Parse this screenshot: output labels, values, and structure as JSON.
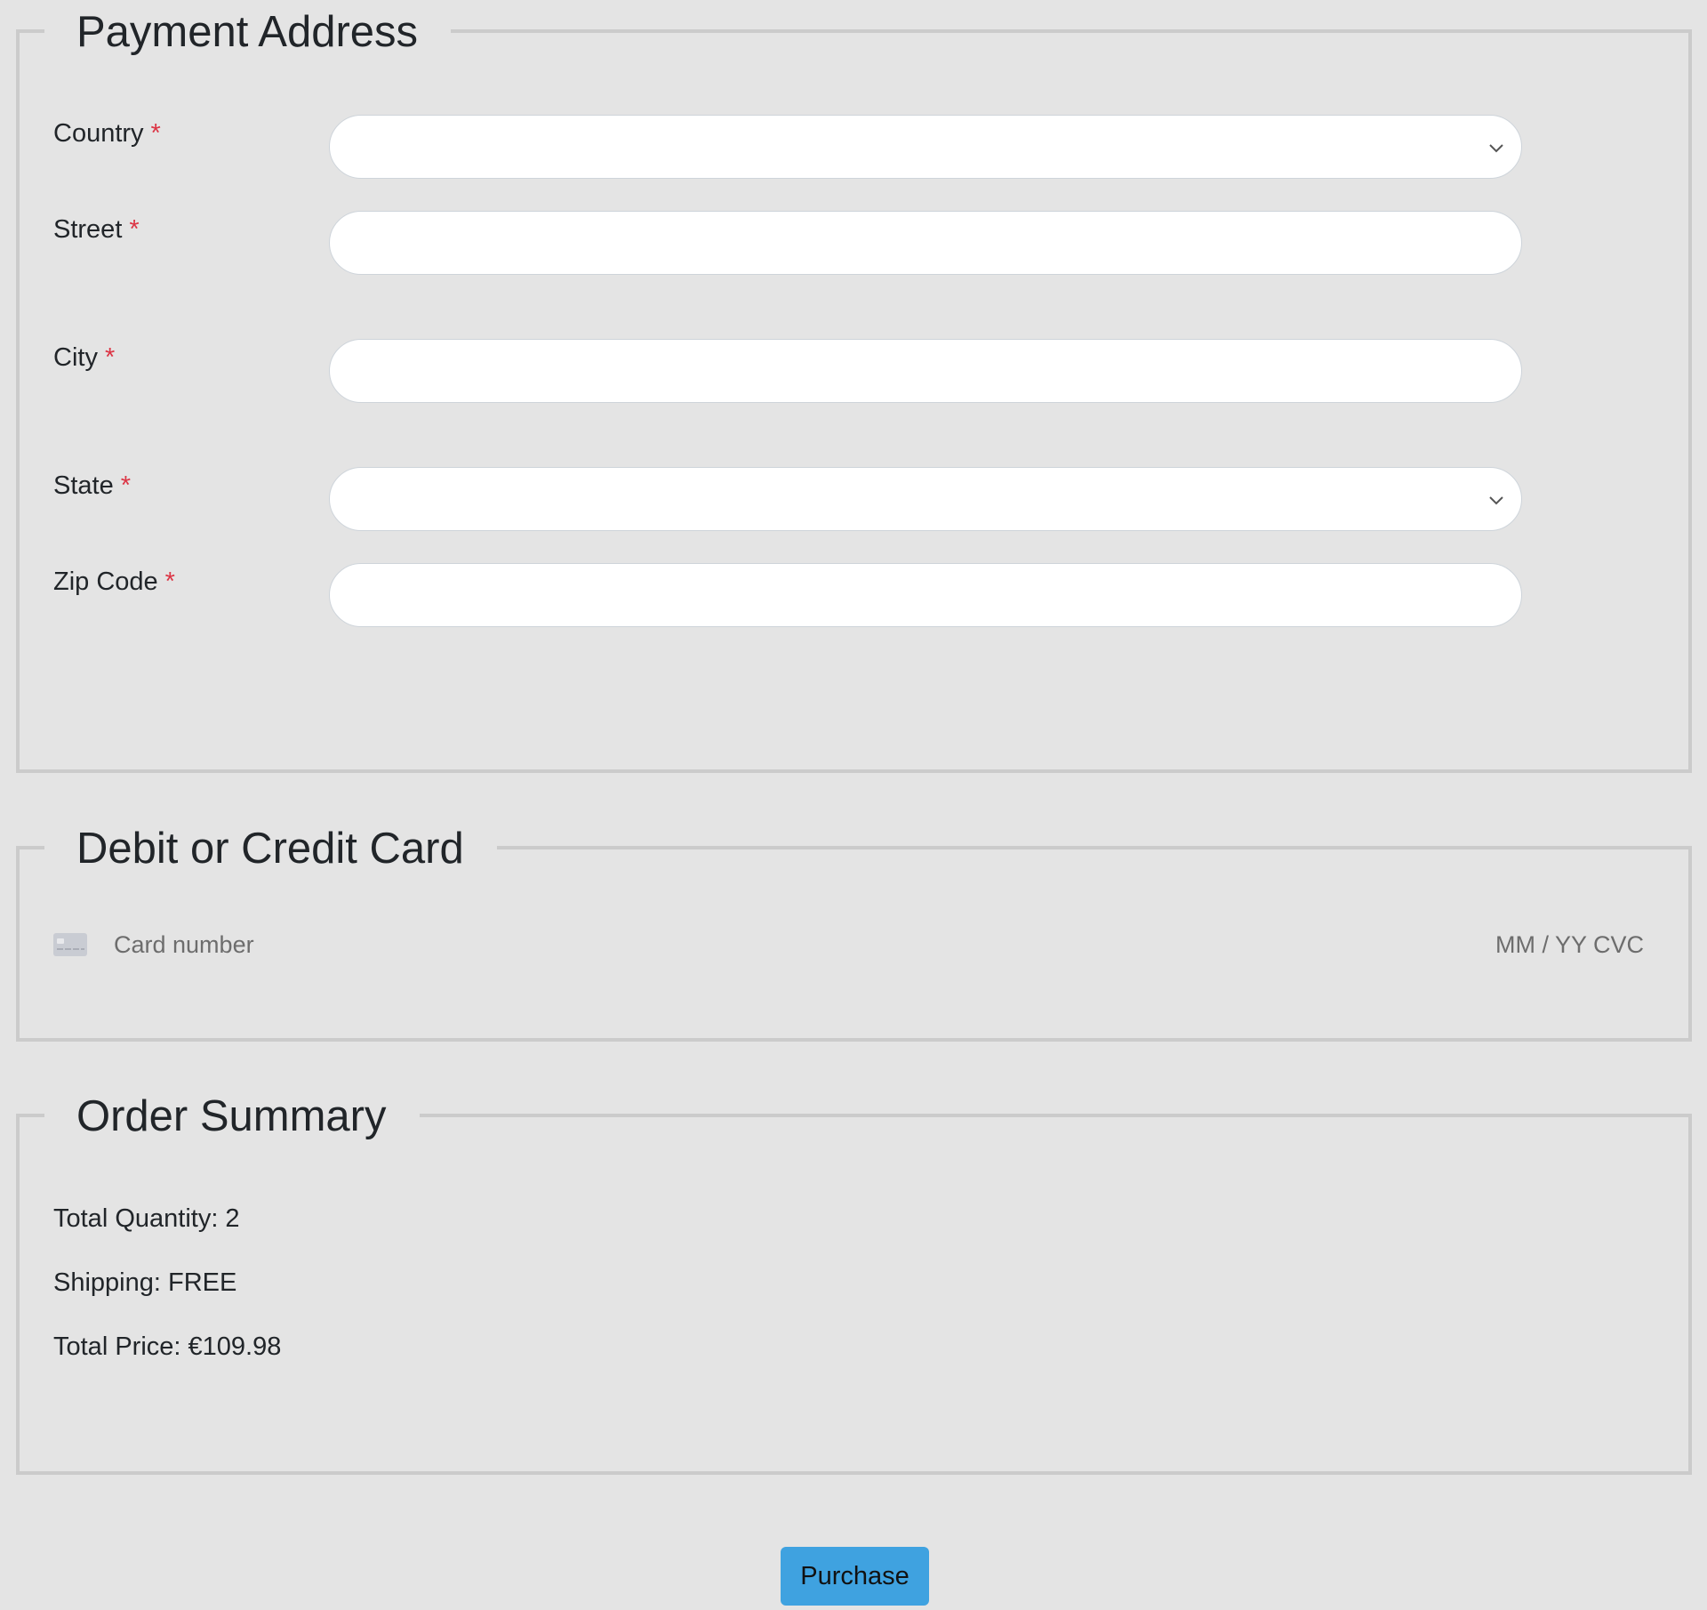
{
  "payment_address": {
    "legend": "Payment Address",
    "required_marker": "*",
    "fields": {
      "country": {
        "label": "Country",
        "value": ""
      },
      "street": {
        "label": "Street",
        "value": ""
      },
      "city": {
        "label": "City",
        "value": ""
      },
      "state": {
        "label": "State",
        "value": ""
      },
      "zip": {
        "label": "Zip Code",
        "value": ""
      }
    }
  },
  "card": {
    "legend": "Debit or Credit Card",
    "number_placeholder": "Card number",
    "expiry_placeholder": "MM / YY",
    "cvc_placeholder": "CVC",
    "icon": "credit-card-icon"
  },
  "order_summary": {
    "legend": "Order Summary",
    "total_quantity": "Total Quantity: 2",
    "shipping": "Shipping: FREE",
    "total_price": "Total Price: €109.98"
  },
  "purchase_button": {
    "label": "Purchase"
  },
  "colors": {
    "background": "#e4e4e4",
    "border": "#cbcbcb",
    "required": "#dc3545",
    "button": "#3fa2e0"
  }
}
